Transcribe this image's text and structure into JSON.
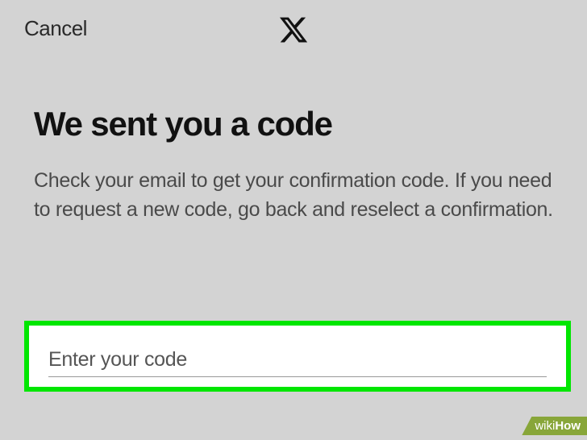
{
  "header": {
    "cancel_label": "Cancel"
  },
  "main": {
    "title": "We sent you a code",
    "description": "Check your email to get your confirmation code. If you need to request a new code, go back and reselect a confirmation."
  },
  "input": {
    "label": "Enter your code"
  },
  "watermark": {
    "part1": "wiki",
    "part2": "How"
  }
}
